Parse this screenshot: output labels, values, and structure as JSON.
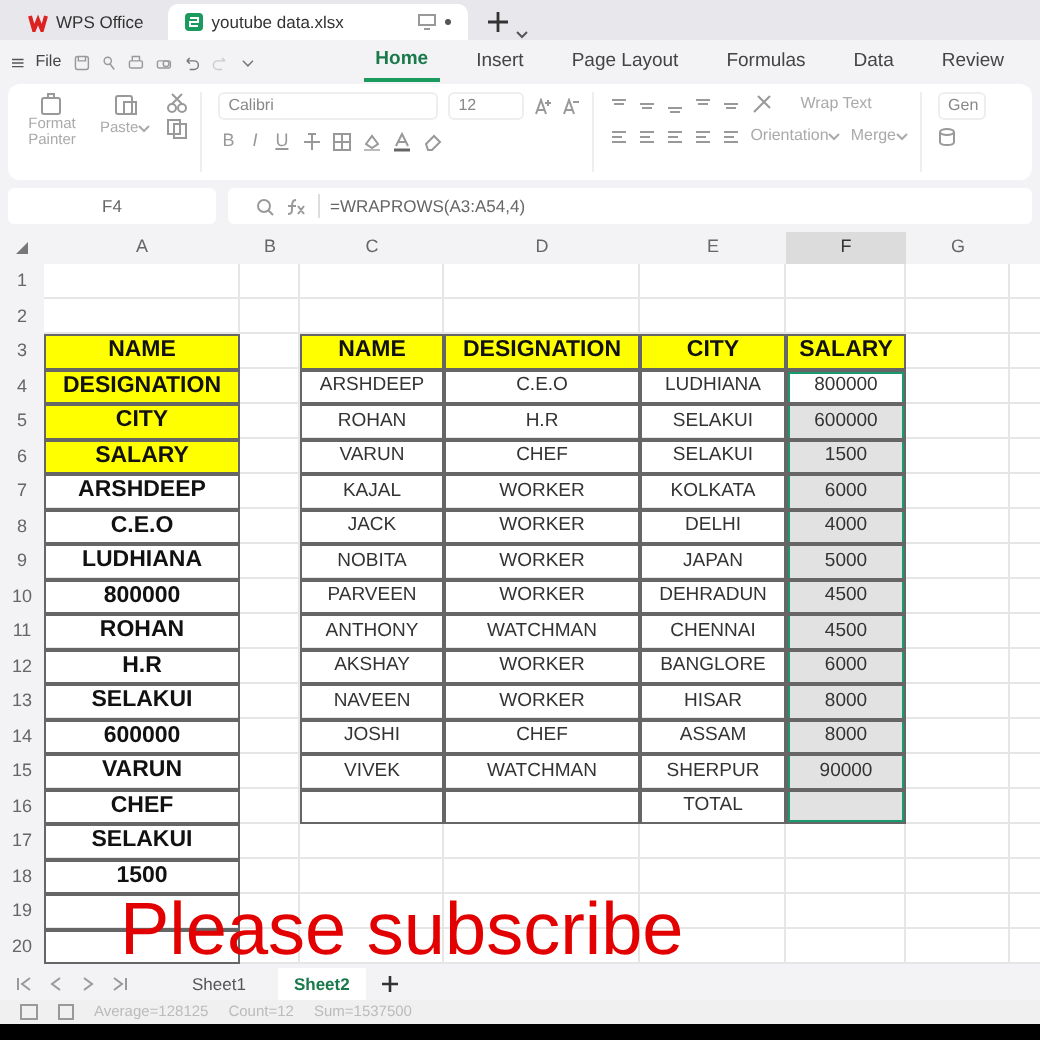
{
  "app_tabs": [
    {
      "label": "WPS Office",
      "kind": "home",
      "selected": false
    },
    {
      "label": "youtube data.xlsx",
      "kind": "doc",
      "selected": true
    }
  ],
  "menu": {
    "file": "File",
    "ribbon_tabs": [
      {
        "label": "Home",
        "selected": true
      },
      {
        "label": "Insert",
        "selected": false
      },
      {
        "label": "Page Layout",
        "selected": false
      },
      {
        "label": "Formulas",
        "selected": false
      },
      {
        "label": "Data",
        "selected": false
      },
      {
        "label": "Review",
        "selected": false
      }
    ]
  },
  "ribbon": {
    "format_painter": "Format Painter",
    "paste": "Paste",
    "font": "Calibri",
    "font_size": "12",
    "text_styles": [
      "B",
      "I",
      "U"
    ],
    "orientation": "Orientation",
    "wrap_text": "Wrap Text",
    "merge": "Merge",
    "number_format": "Gen"
  },
  "formula_bar": {
    "name_box": "F4",
    "formula": "=WRAPROWS(A3:A54,4)"
  },
  "sheet": {
    "columns": [
      {
        "label": "A",
        "selected": false
      },
      {
        "label": "B",
        "selected": false
      },
      {
        "label": "C",
        "selected": false
      },
      {
        "label": "D",
        "selected": false
      },
      {
        "label": "E",
        "selected": false
      },
      {
        "label": "F",
        "selected": true
      },
      {
        "label": "G",
        "selected": false
      }
    ],
    "rows": [
      "1",
      "2",
      "3",
      "4",
      "5",
      "6",
      "7",
      "8",
      "9",
      "10",
      "11",
      "12",
      "13",
      "14",
      "15",
      "16",
      "17",
      "18",
      "19",
      "20"
    ],
    "column_a": [
      {
        "text": "NAME",
        "header": true
      },
      {
        "text": "DESIGNATION",
        "header": true
      },
      {
        "text": "CITY",
        "header": true
      },
      {
        "text": "SALARY",
        "header": true
      },
      {
        "text": "ARSHDEEP",
        "header": false
      },
      {
        "text": "C.E.O",
        "header": false
      },
      {
        "text": "LUDHIANA",
        "header": false
      },
      {
        "text": "800000",
        "header": false
      },
      {
        "text": "ROHAN",
        "header": false
      },
      {
        "text": "H.R",
        "header": false
      },
      {
        "text": "SELAKUI",
        "header": false
      },
      {
        "text": "600000",
        "header": false
      },
      {
        "text": "VARUN",
        "header": false
      },
      {
        "text": "CHEF",
        "header": false
      },
      {
        "text": "SELAKUI",
        "header": false
      },
      {
        "text": "1500",
        "header": false
      },
      {
        "header": false
      },
      {
        "header": false
      }
    ],
    "table": {
      "columns": [
        "NAME",
        "DESIGNATION",
        "CITY",
        "SALARY"
      ],
      "rows": [
        {
          "name": "ARSHDEEP",
          "designation": "C.E.O",
          "city": "LUDHIANA",
          "salary": "800000",
          "selected": true,
          "active": true
        },
        {
          "name": "ROHAN",
          "designation": "H.R",
          "city": "SELAKUI",
          "salary": "600000",
          "selected": true,
          "active": false
        },
        {
          "name": "VARUN",
          "designation": "CHEF",
          "city": "SELAKUI",
          "salary": "1500",
          "selected": true,
          "active": false
        },
        {
          "name": "KAJAL",
          "designation": "WORKER",
          "city": "KOLKATA",
          "salary": "6000",
          "selected": true,
          "active": false
        },
        {
          "name": "JACK",
          "designation": "WORKER",
          "city": "DELHI",
          "salary": "4000",
          "selected": true,
          "active": false
        },
        {
          "name": "NOBITA",
          "designation": "WORKER",
          "city": "JAPAN",
          "salary": "5000",
          "selected": true,
          "active": false
        },
        {
          "name": "PARVEEN",
          "designation": "WORKER",
          "city": "DEHRADUN",
          "salary": "4500",
          "selected": true,
          "active": false
        },
        {
          "name": "ANTHONY",
          "designation": "WATCHMAN",
          "city": "CHENNAI",
          "salary": "4500",
          "selected": true,
          "active": false
        },
        {
          "name": "AKSHAY",
          "designation": "WORKER",
          "city": "BANGLORE",
          "salary": "6000",
          "selected": true,
          "active": false
        },
        {
          "name": "NAVEEN",
          "designation": "WORKER",
          "city": "HISAR",
          "salary": "8000",
          "selected": true,
          "active": false
        },
        {
          "name": "JOSHI",
          "designation": "CHEF",
          "city": "ASSAM",
          "salary": "8000",
          "selected": true,
          "active": false
        },
        {
          "name": "VIVEK",
          "designation": "WATCHMAN",
          "city": "SHERPUR",
          "salary": "90000",
          "selected": true,
          "active": false
        },
        {
          "city": "TOTAL",
          "selected": true,
          "active": false
        }
      ]
    }
  },
  "caption": "Please subscribe",
  "sheet_tabs": [
    {
      "label": "Sheet1",
      "selected": false
    },
    {
      "label": "Sheet2",
      "selected": true
    }
  ],
  "status_bar": [
    "Average=128125",
    "Count=12",
    "Sum=1537500"
  ]
}
